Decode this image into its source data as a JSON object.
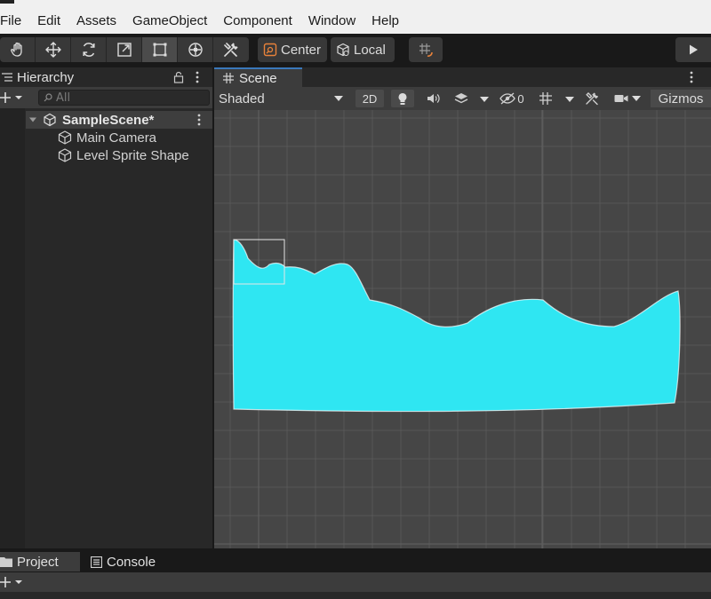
{
  "menu": {
    "items": [
      "File",
      "Edit",
      "Assets",
      "GameObject",
      "Component",
      "Window",
      "Help"
    ]
  },
  "toolbar": {
    "tools": [
      {
        "name": "hand-tool",
        "icon": "hand-icon"
      },
      {
        "name": "move-tool",
        "icon": "move-arrows-icon"
      },
      {
        "name": "rotate-tool",
        "icon": "rotate-icon"
      },
      {
        "name": "scale-tool",
        "icon": "scale-icon"
      },
      {
        "name": "rect-tool",
        "icon": "rect-transform-icon",
        "active": true
      },
      {
        "name": "transform-tool",
        "icon": "transform-icon"
      },
      {
        "name": "custom-tool",
        "icon": "custom-tools-icon"
      }
    ],
    "pivot_label": "Center",
    "space_label": "Local"
  },
  "hierarchy": {
    "tab_label": "Hierarchy",
    "search_placeholder": "All",
    "scene_name": "SampleScene*",
    "objects": [
      "Main Camera",
      "Level Sprite Shape"
    ]
  },
  "scene": {
    "tab_label": "Scene",
    "shading_mode": "Shaded",
    "mode_2d": "2D",
    "hidden_count": "0",
    "gizmos_label": "Gizmos",
    "shape_color": "#2fe6f2",
    "grid_color": "#575757",
    "background_color": "#464646"
  },
  "bottom": {
    "project_label": "Project",
    "console_label": "Console"
  },
  "colors": {
    "accent": "#3a79bb",
    "panel": "#3c3c3c",
    "menubar": "#f0f0f0"
  }
}
